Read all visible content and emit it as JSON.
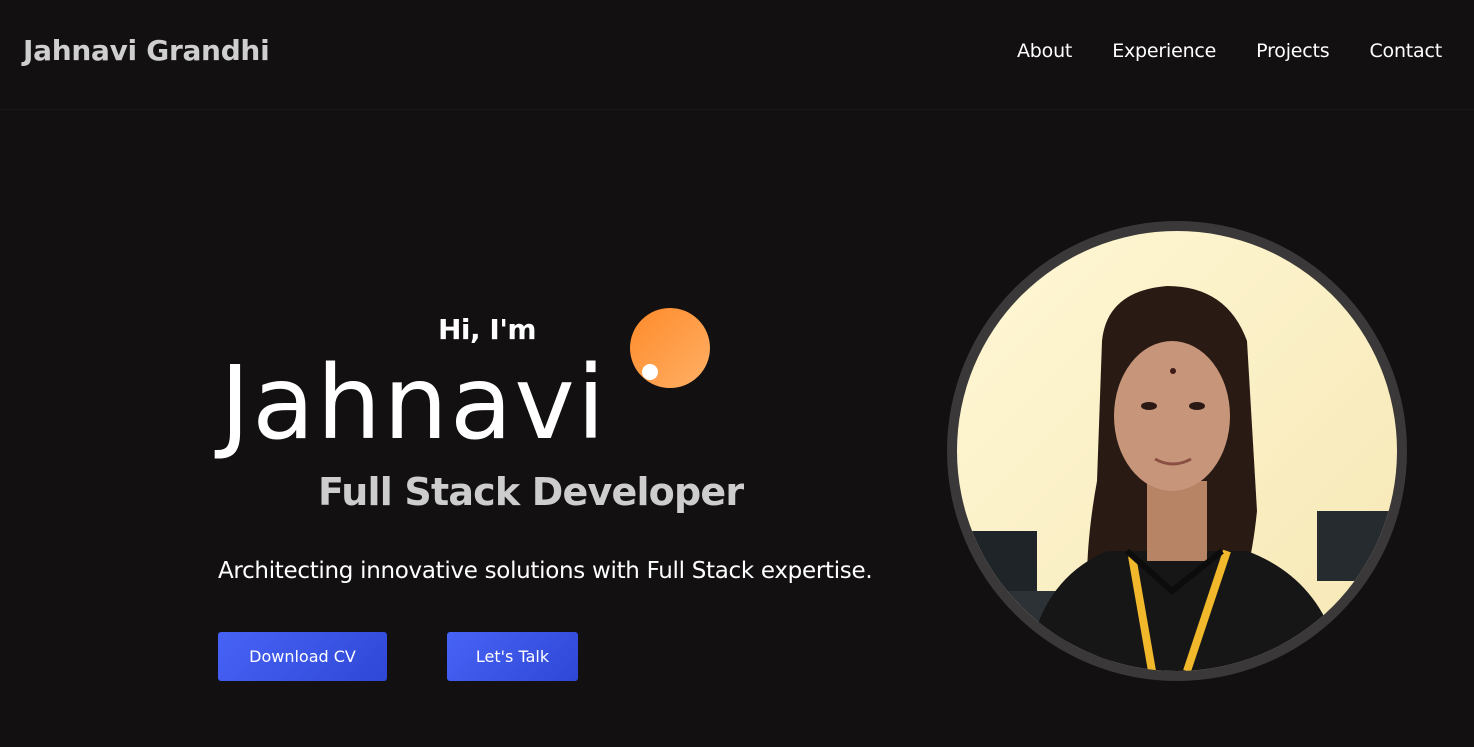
{
  "header": {
    "brand": "Jahnavi Grandhi",
    "nav": [
      "About",
      "Experience",
      "Projects",
      "Contact"
    ]
  },
  "hero": {
    "greeting": "Hi, I'm",
    "name": "Jahnavi",
    "role": "Full Stack Developer",
    "tagline": "Architecting innovative solutions with Full Stack expertise.",
    "buttons": {
      "download_cv": "Download CV",
      "lets_talk": "Let's Talk"
    }
  },
  "colors": {
    "background": "#121010",
    "accent_button": "#3f58ec",
    "orb": "#ff9a3c",
    "portrait_border": "#3a3838"
  }
}
